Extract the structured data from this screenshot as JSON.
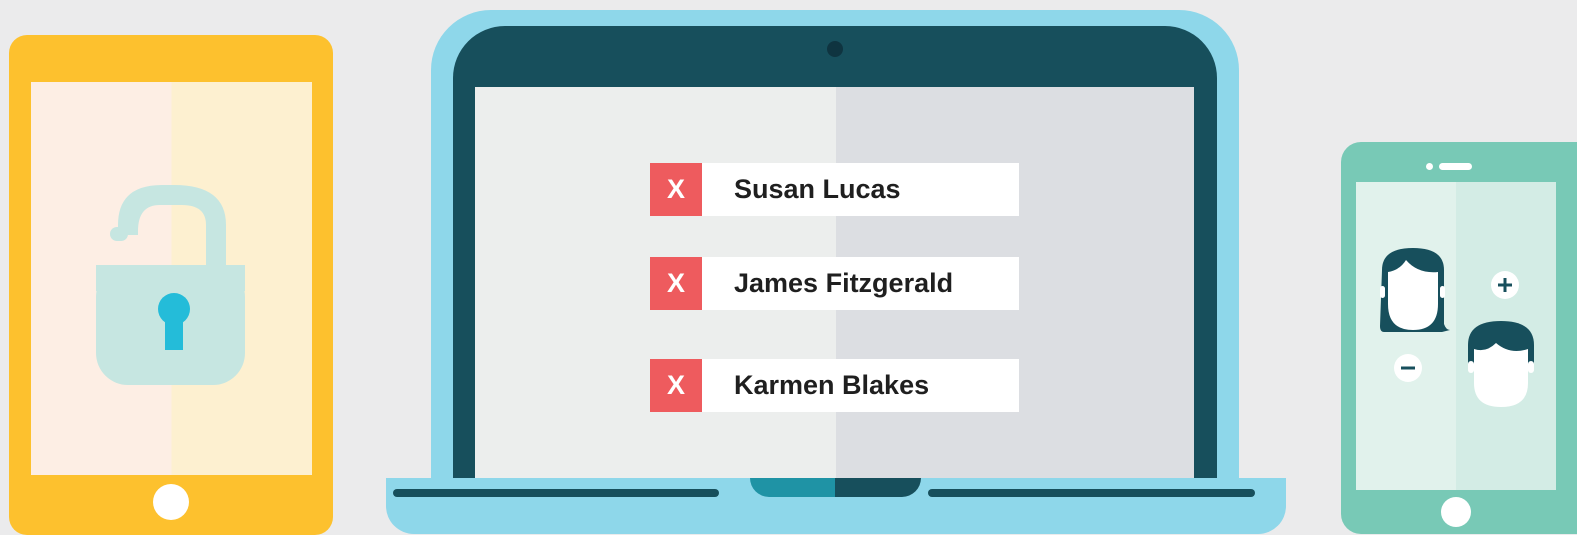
{
  "contacts": [
    {
      "remove_label": "X",
      "name": "Susan Lucas"
    },
    {
      "remove_label": "X",
      "name": "James Fitzgerald"
    },
    {
      "remove_label": "X",
      "name": "Karmen Blakes"
    }
  ],
  "colors": {
    "background": "#ebebec",
    "tablet": "#fdc12e",
    "laptop_frame": "#8ed7ea",
    "laptop_bezel": "#174f5c",
    "remove_button": "#ee5b5e",
    "phone": "#78c9b6",
    "lock": "#c6e6e1",
    "keyhole": "#24bcd9"
  },
  "icons": {
    "tablet": "unlocked-padlock-icon",
    "phone_left": "female-user-icon",
    "phone_right": "male-user-icon",
    "add": "plus-icon",
    "remove": "minus-icon"
  }
}
